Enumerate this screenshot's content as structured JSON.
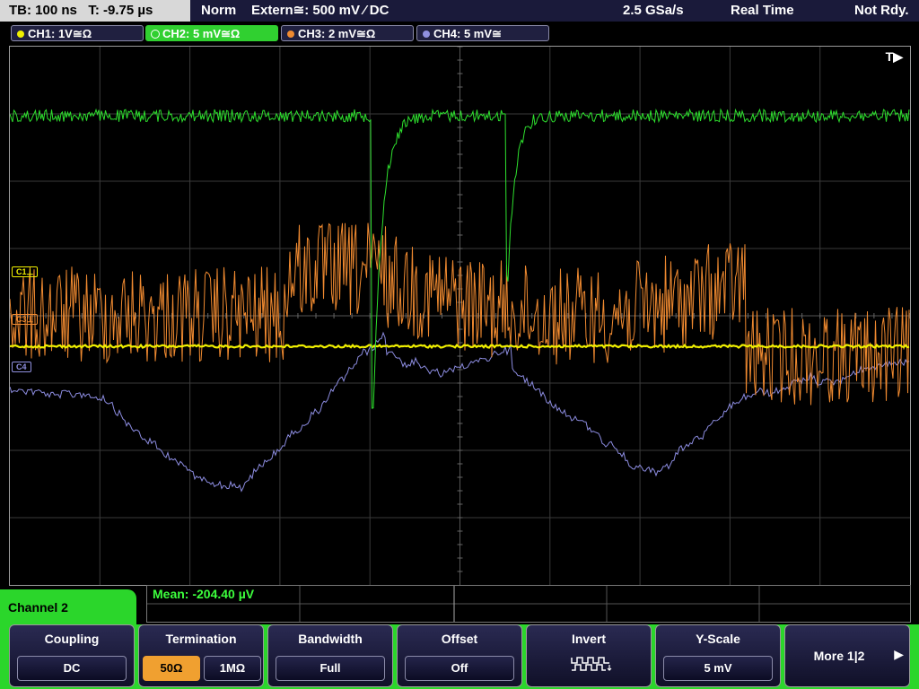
{
  "status": {
    "timebase": "TB: 100 ns   T: -9.75 µs",
    "mode": "Norm",
    "trigger": "Extern≅: 500 mV ⁄ DC",
    "sample_rate": "2.5 GSa/s",
    "acq_mode": "Real Time",
    "state": "Not Rdy."
  },
  "channels": [
    {
      "label": "CH1: 1V≅Ω",
      "color": "#f0f000",
      "active": false
    },
    {
      "label": "CH2: 5 mV≅Ω",
      "color": "#30d030",
      "active": true
    },
    {
      "label": "CH3: 2 mV≅Ω",
      "color": "#f08a30",
      "active": false
    },
    {
      "label": "CH4: 5 mV≅",
      "color": "#9090e0",
      "active": false
    }
  ],
  "screen": {
    "trigger_marker": "T▶",
    "markers": {
      "c1": "C1⊥",
      "c3": "C3⊥",
      "c4": "C4"
    }
  },
  "measurement": {
    "text": "Mean: -204.40 µV"
  },
  "menu": {
    "title": "Channel 2",
    "softkeys": [
      {
        "title": "Coupling",
        "value": "DC"
      },
      {
        "title": "Termination",
        "opt1": "50Ω",
        "opt2": "1MΩ"
      },
      {
        "title": "Bandwidth",
        "value": "Full"
      },
      {
        "title": "Offset",
        "value": "Off"
      },
      {
        "title": "Invert",
        "icon": "square-wave-icon"
      },
      {
        "title": "Y-Scale",
        "value": "5 mV"
      },
      {
        "title": "More 1|2"
      }
    ]
  }
}
